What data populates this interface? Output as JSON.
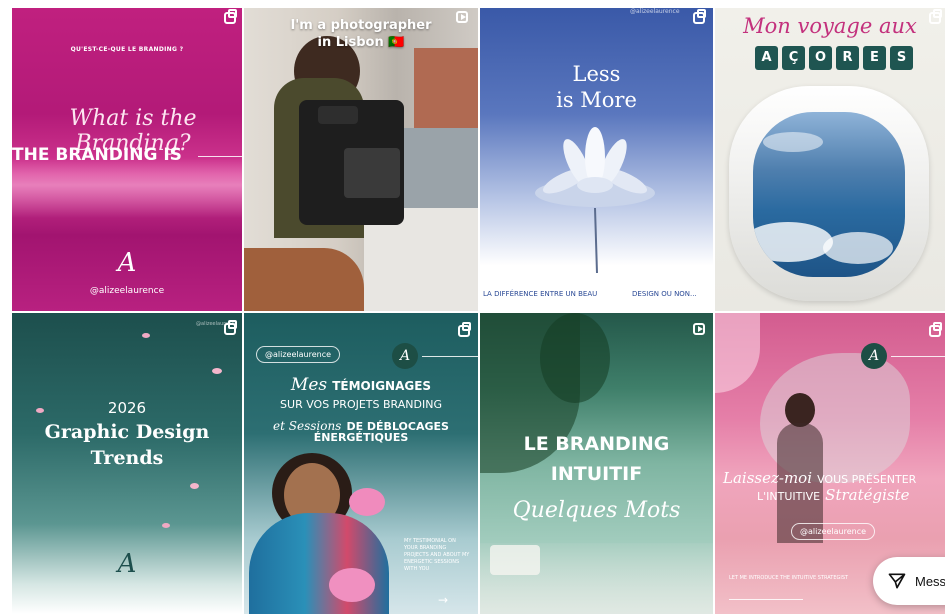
{
  "posts": [
    {
      "kicker": "QU'EST-CE-QUE LE BRANDING ?",
      "script_title": "What is the Branding?",
      "headline": "THE BRANDING IS",
      "signature": "A",
      "handle": "@alizeelaurence",
      "icon": "multi-image-icon"
    },
    {
      "caption_line1": "I'm a photographer",
      "caption_line2": "in Lisbon",
      "flag": "🇵🇹",
      "icon": "reel-icon"
    },
    {
      "title_line1": "Less",
      "title_line2": "is More",
      "footer_left": "LA DIFFÉRENCE ENTRE UN BEAU",
      "footer_right": "DESIGN OU NON...",
      "handle": "@alizeelaurence",
      "icon": "multi-image-icon"
    },
    {
      "script_title": "Mon voyage aux",
      "letters": [
        "A",
        "Ç",
        "O",
        "R",
        "E",
        "S"
      ],
      "icon": "multi-image-icon"
    },
    {
      "year": "2026",
      "title_line1": "Graphic Design",
      "title_line2": "Trends",
      "signature": "A",
      "handle": "@alizeelaurence",
      "icon": "multi-image-icon"
    },
    {
      "handle": "@alizeelaurence",
      "script1": "Mes",
      "line1": "TÉMOIGNAGES",
      "line2": "SUR VOS PROJETS BRANDING",
      "script2": "et Sessions",
      "line3": "DE DÉBLOCAGES",
      "line4": "ÉNERGÉTIQUES",
      "side_text": "MY TESTIMONIAL ON YOUR BRANDING PROJECTS AND ABOUT MY ENERGETIC SESSIONS WITH YOU",
      "arrow": "→",
      "logo": "A",
      "icon": "multi-image-icon"
    },
    {
      "line1": "LE BRANDING",
      "line2": "INTUITIF",
      "script": "Quelques Mots",
      "icon": "reel-icon"
    },
    {
      "script1": "Laissez-moi",
      "line1": "VOUS PRÉSENTER",
      "line2": "L'INTUITIVE",
      "script2": "Stratégiste",
      "handle": "@alizeelaurence",
      "footer": "LET ME INTRODUCE THE INTUITIVE STRATEGIST",
      "logo": "A",
      "icon": "multi-image-icon"
    }
  ],
  "message_button": {
    "label": "Mess",
    "icon": "send-icon"
  }
}
